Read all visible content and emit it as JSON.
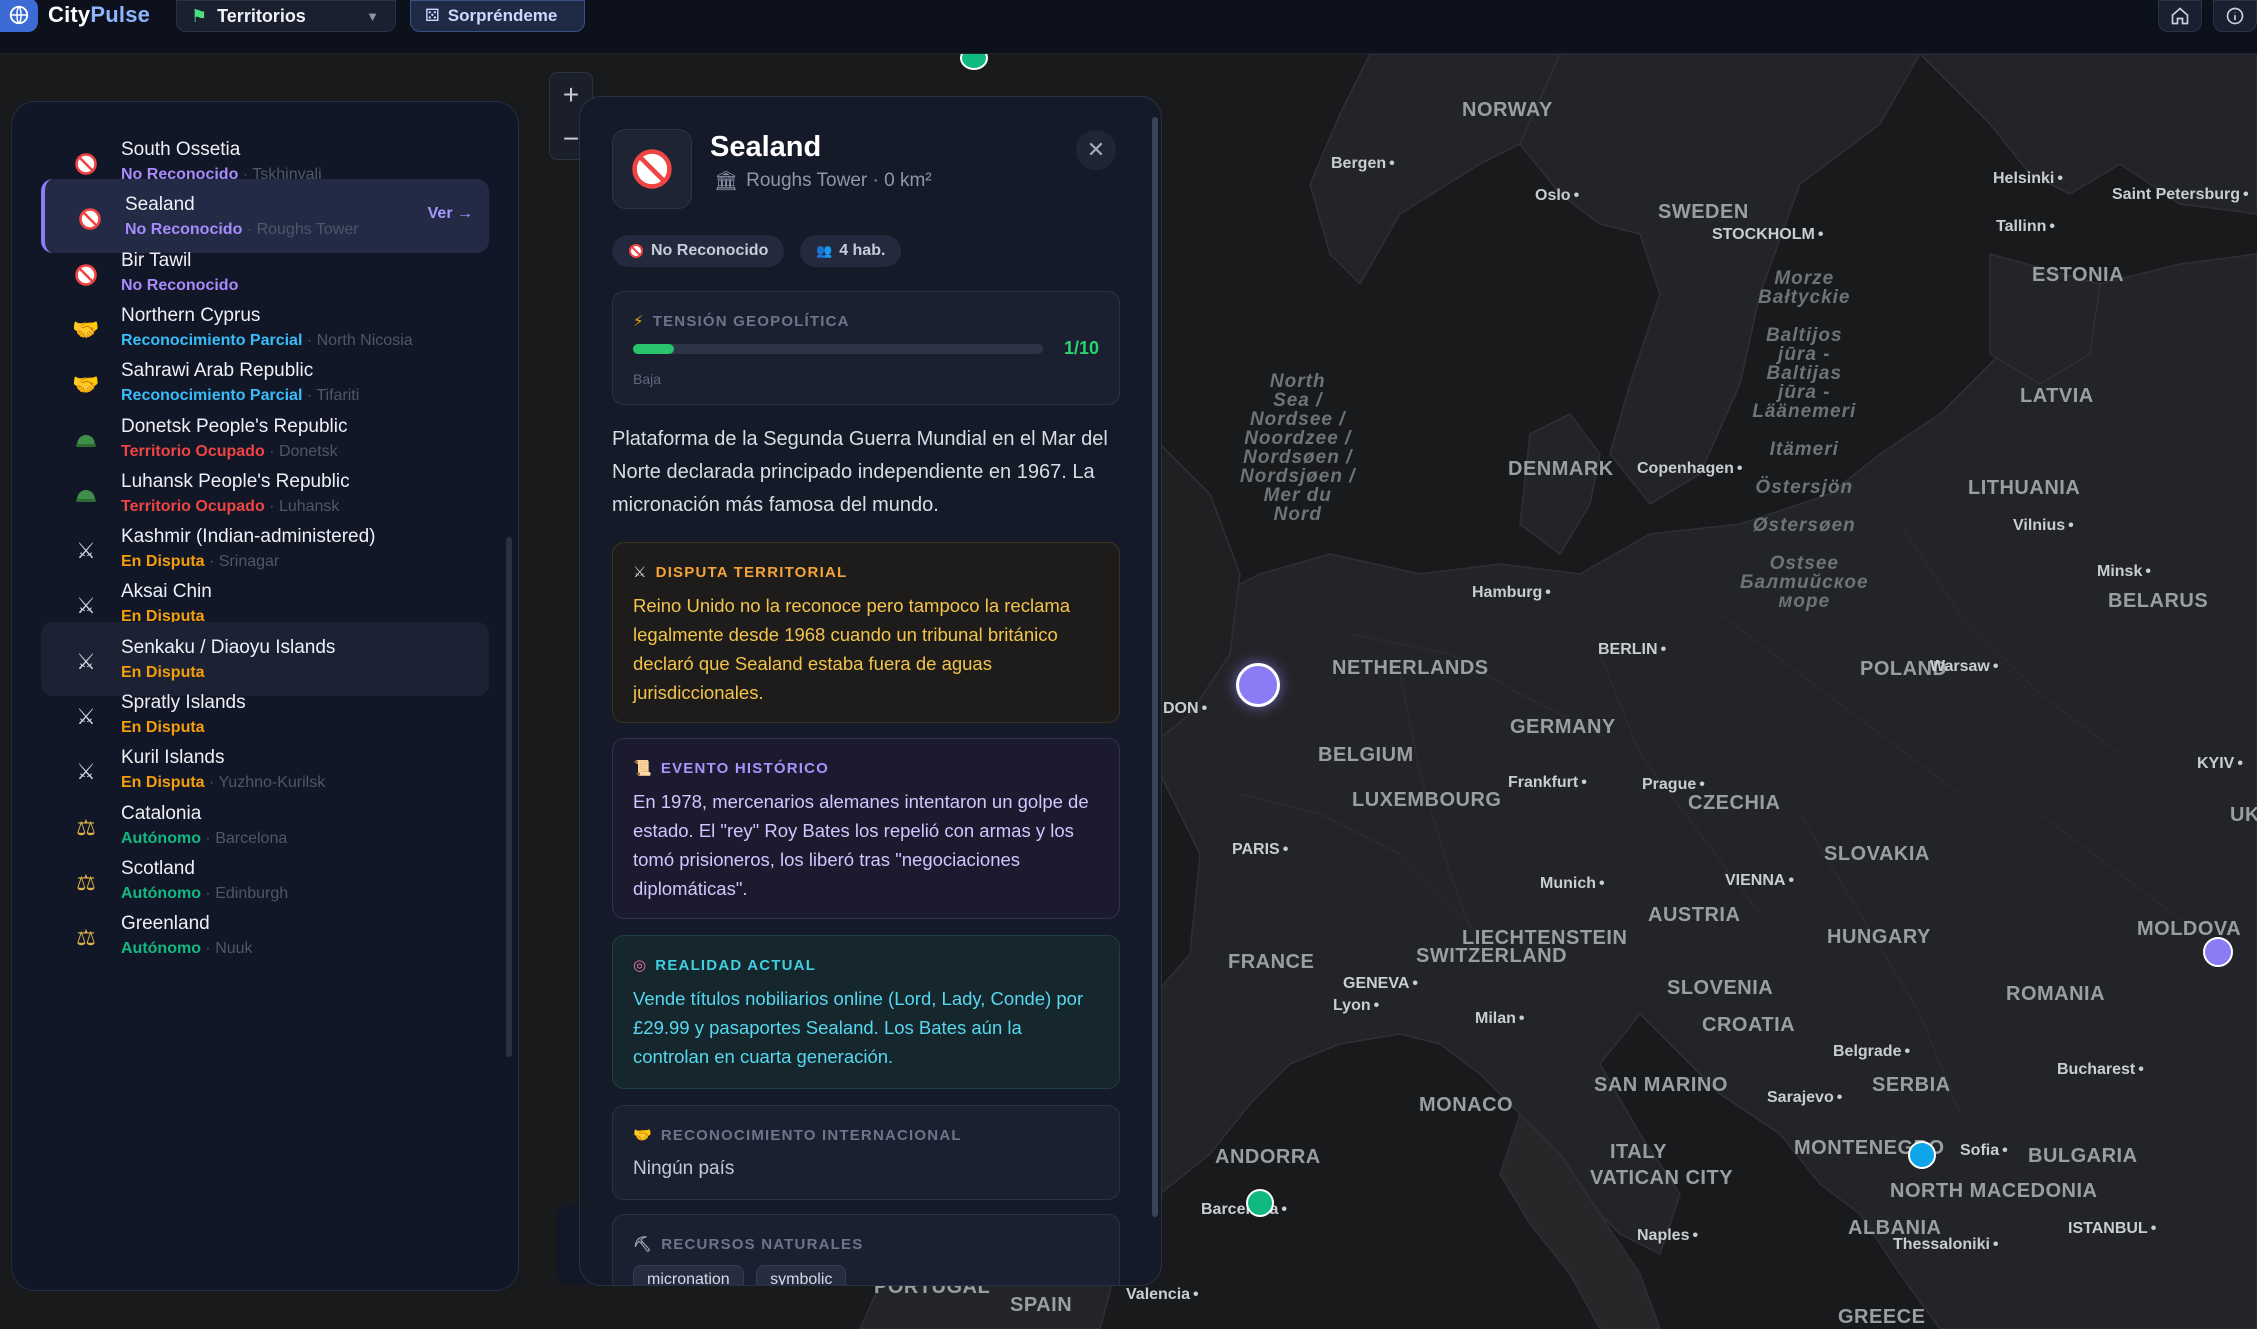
{
  "app": {
    "name_a": "City",
    "name_b": "Pulse"
  },
  "topbar": {
    "territories_label": "Territorios",
    "surprise_label": "Sorpréndeme"
  },
  "sidebar": {
    "items": [
      {
        "name": "South Ossetia",
        "status": "No Reconocido",
        "capital": "Tskhinvali",
        "status_color": "#a78bfa",
        "icon": "prohibited-icon"
      },
      {
        "name": "Sealand",
        "status": "No Reconocido",
        "capital": "Roughs Tower",
        "status_color": "#a78bfa",
        "icon": "prohibited-icon",
        "action": "Ver →"
      },
      {
        "name": "Bir Tawil",
        "status": "No Reconocido",
        "capital": "",
        "status_color": "#a78bfa",
        "icon": "prohibited-icon"
      },
      {
        "name": "Northern Cyprus",
        "status": "Reconocimiento Parcial",
        "capital": "North Nicosia",
        "status_color": "#38bdf8",
        "icon": "handshake-icon"
      },
      {
        "name": "Sahrawi Arab Republic",
        "status": "Reconocimiento Parcial",
        "capital": "Tifariti",
        "status_color": "#38bdf8",
        "icon": "handshake-icon"
      },
      {
        "name": "Donetsk People's Republic",
        "status": "Territorio Ocupado",
        "capital": "Donetsk",
        "status_color": "#ef4444",
        "icon": "military-helmet-icon"
      },
      {
        "name": "Luhansk People's Republic",
        "status": "Territorio Ocupado",
        "capital": "Luhansk",
        "status_color": "#ef4444",
        "icon": "military-helmet-icon"
      },
      {
        "name": "Kashmir (Indian-administered)",
        "status": "En Disputa",
        "capital": "Srinagar",
        "status_color": "#f59e0b",
        "icon": "crossed-swords-icon"
      },
      {
        "name": "Aksai Chin",
        "status": "En Disputa",
        "capital": "",
        "status_color": "#f59e0b",
        "icon": "crossed-swords-icon"
      },
      {
        "name": "Senkaku / Diaoyu Islands",
        "status": "En Disputa",
        "capital": "",
        "status_color": "#f59e0b",
        "icon": "crossed-swords-icon"
      },
      {
        "name": "Spratly Islands",
        "status": "En Disputa",
        "capital": "",
        "status_color": "#f59e0b",
        "icon": "crossed-swords-icon"
      },
      {
        "name": "Kuril Islands",
        "status": "En Disputa",
        "capital": "Yuzhno-Kurilsk",
        "status_color": "#f59e0b",
        "icon": "crossed-swords-icon"
      },
      {
        "name": "Catalonia",
        "status": "Autónomo",
        "capital": "Barcelona",
        "status_color": "#10b981",
        "icon": "scales-icon"
      },
      {
        "name": "Scotland",
        "status": "Autónomo",
        "capital": "Edinburgh",
        "status_color": "#10b981",
        "icon": "scales-icon"
      },
      {
        "name": "Greenland",
        "status": "Autónomo",
        "capital": "Nuuk",
        "status_color": "#10b981",
        "icon": "scales-icon"
      }
    ]
  },
  "detail": {
    "title": "Sealand",
    "subtitle": "Roughs Tower · 0 km²",
    "status_chip": "No Reconocido",
    "population_chip": "4 hab.",
    "tension_heading": "TENSIÓN GEOPOLÍTICA",
    "tension_value": "1/10",
    "tension_fraction": 0.1,
    "tension_level": "Baja",
    "description": "Plataforma de la Segunda Guerra Mundial en el Mar del Norte declarada principado independiente en 1967. La micronación más famosa del mundo.",
    "dispute_heading": "DISPUTA TERRITORIAL",
    "dispute_text": "Reino Unido no la reconoce pero tampoco la reclama legalmente desde 1968 cuando un tribunal británico declaró que Sealand estaba fuera de aguas jurisdiccionales.",
    "event_heading": "EVENTO HISTÓRICO",
    "event_text": "En 1978, mercenarios alemanes intentaron un golpe de estado. El \"rey\" Roy Bates los repelió con armas y los tomó prisioneros, los liberó tras \"negociaciones diplomáticas\".",
    "reality_heading": "REALIDAD ACTUAL",
    "reality_text": "Vende títulos nobiliarios online (Lord, Lady, Conde) por £29.99 y pasaportes Sealand. Los Bates aún la controlan en cuarta generación.",
    "recognition_heading": "RECONOCIMIENTO INTERNACIONAL",
    "recognition_text": "Ningún país",
    "resources_heading": "RECURSOS NATURALES",
    "resources": [
      "micronation",
      "symbolic"
    ]
  },
  "map": {
    "countries": [
      "NORWAY",
      "SWEDEN",
      "ESTONIA",
      "LATVIA",
      "LITHUANIA",
      "BELARUS",
      "DENMARK",
      "NETHERLANDS",
      "BELGIUM",
      "LUXEMBOURG",
      "GERMANY",
      "POLAND",
      "CZECHIA",
      "SLOVAKIA",
      "AUSTRIA",
      "HUNGARY",
      "LIECHTENSTEIN",
      "SWITZERLAND",
      "FRANCE",
      "SLOVENIA",
      "CROATIA",
      "ROMANIA",
      "SERBIA",
      "MOLDOVA",
      "MONACO",
      "SAN MARINO",
      "ITALY",
      "VATICAN CITY",
      "ANDORRA",
      "MONTENEGRO",
      "NORTH MACEDONIA",
      "ALBANIA",
      "BULGARIA",
      "PORTUGAL",
      "SPAIN",
      "GREECE",
      "UK"
    ],
    "cities": [
      "Bergen",
      "Oslo",
      "STOCKHOLM",
      "Helsinki",
      "Saint Petersburg",
      "Tallinn",
      "Copenhagen",
      "Vilnius",
      "Minsk",
      "Hamburg",
      "BERLIN",
      "Warsaw",
      "Frankfurt",
      "Prague",
      "PARIS",
      "Munich",
      "VIENNA",
      "KYIV",
      "GENEVA",
      "Lyon",
      "Milan",
      "Belgrade",
      "Bucharest",
      "Sarajevo",
      "Sofia",
      "Barcelona",
      "Naples",
      "Thessaloniki",
      "ISTANBUL",
      "Valencia",
      "DON"
    ],
    "seas": {
      "north_sea": "North Sea / Nordsee / Noordzee / Nordsøen / Nordsjøen / Mer du Nord",
      "baltic": "Morze Bałtyckie / Baltijos jūra - Baltijas jūra - Läänemeri / Itämeri / Östersjön / Østersøen / Ostsee / Балтийское море"
    }
  }
}
